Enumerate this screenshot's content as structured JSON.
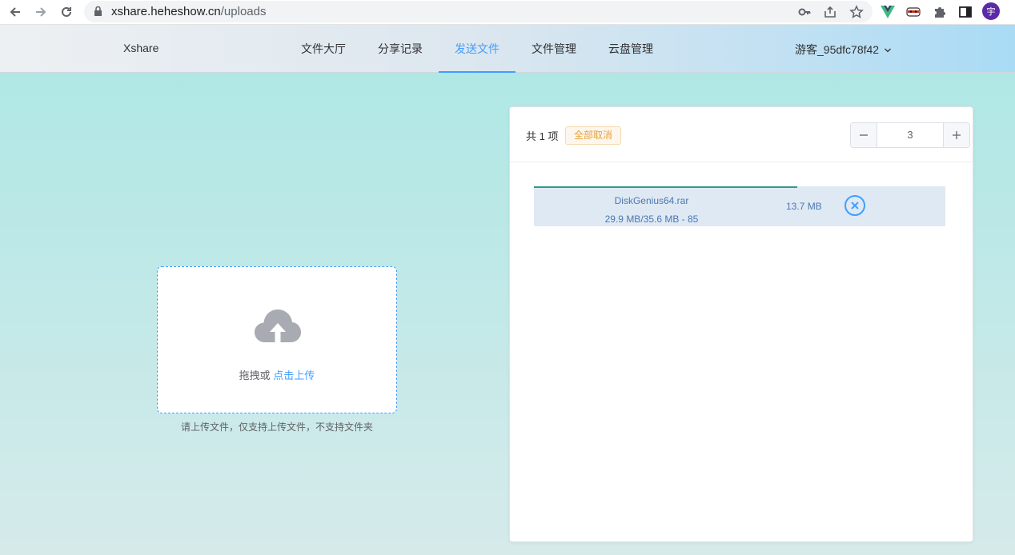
{
  "browser": {
    "url_host": "xshare.heheshow.cn",
    "url_path": "/uploads",
    "avatar_letter": "宇"
  },
  "header": {
    "brand": "Xshare",
    "nav": [
      {
        "label": "文件大厅",
        "active": false
      },
      {
        "label": "分享记录",
        "active": false
      },
      {
        "label": "发送文件",
        "active": true
      },
      {
        "label": "文件管理",
        "active": false
      },
      {
        "label": "云盘管理",
        "active": false
      }
    ],
    "user": "游客_95dfc78f42"
  },
  "upload": {
    "drag_text": "拖拽或 ",
    "click_text": "点击上传",
    "tip": "请上传文件，仅支持上传文件，不支持文件夹"
  },
  "panel": {
    "count_text": "共 1 项",
    "cancel_all": "全部取消",
    "concurrency": "3",
    "files": [
      {
        "name": "DiskGenius64.rar",
        "progress_text": "29.9 MB/35.6 MB - 85",
        "size": "13.7 MB",
        "progress": 0.64
      }
    ]
  },
  "colors": {
    "accent": "#409eff",
    "warning": "#e6a23c",
    "progress": "#2e9a8a"
  }
}
